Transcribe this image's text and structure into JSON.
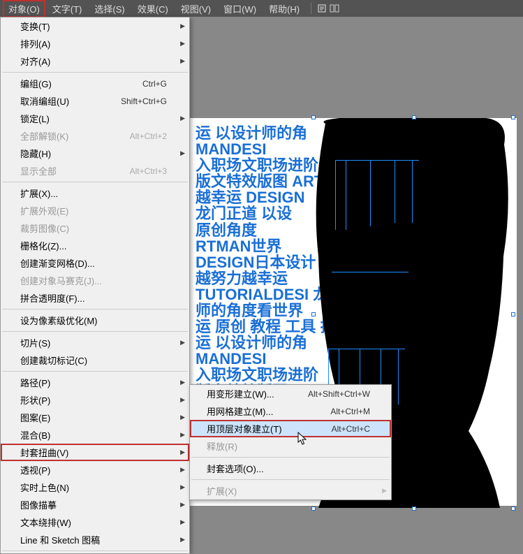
{
  "menubar": {
    "items": [
      {
        "label": "对象(O)",
        "active": true
      },
      {
        "label": "文字(T)"
      },
      {
        "label": "选择(S)"
      },
      {
        "label": "效果(C)"
      },
      {
        "label": "视图(V)"
      },
      {
        "label": "窗口(W)"
      },
      {
        "label": "帮助(H)"
      }
    ]
  },
  "object_menu": {
    "items": [
      {
        "label": "变换(T)",
        "sub": true
      },
      {
        "label": "排列(A)",
        "sub": true
      },
      {
        "label": "对齐(A)",
        "sub": true
      },
      {
        "sep": true
      },
      {
        "label": "编组(G)",
        "shortcut": "Ctrl+G"
      },
      {
        "label": "取消编组(U)",
        "shortcut": "Shift+Ctrl+G"
      },
      {
        "label": "锁定(L)",
        "sub": true
      },
      {
        "label": "全部解锁(K)",
        "shortcut": "Alt+Ctrl+2",
        "disabled": true
      },
      {
        "label": "隐藏(H)",
        "sub": true
      },
      {
        "label": "显示全部",
        "shortcut": "Alt+Ctrl+3",
        "disabled": true
      },
      {
        "sep": true
      },
      {
        "label": "扩展(X)..."
      },
      {
        "label": "扩展外观(E)",
        "disabled": true
      },
      {
        "label": "裁剪图像(C)",
        "disabled": true
      },
      {
        "label": "栅格化(Z)..."
      },
      {
        "label": "创建渐变网格(D)..."
      },
      {
        "label": "创建对象马赛克(J)...",
        "disabled": true
      },
      {
        "label": "拼合透明度(F)..."
      },
      {
        "sep": true
      },
      {
        "label": "设为像素级优化(M)"
      },
      {
        "sep": true
      },
      {
        "label": "切片(S)",
        "sub": true
      },
      {
        "label": "创建裁切标记(C)"
      },
      {
        "sep": true
      },
      {
        "label": "路径(P)",
        "sub": true
      },
      {
        "label": "形状(P)",
        "sub": true
      },
      {
        "label": "图案(E)",
        "sub": true
      },
      {
        "label": "混合(B)",
        "sub": true
      },
      {
        "label": "封套扭曲(V)",
        "sub": true,
        "highlight": true
      },
      {
        "label": "透视(P)",
        "sub": true
      },
      {
        "label": "实时上色(N)",
        "sub": true
      },
      {
        "label": "图像描摹",
        "sub": true
      },
      {
        "label": "文本绕排(W)",
        "sub": true
      },
      {
        "label": "Line 和 Sketch 图稿",
        "sub": true
      },
      {
        "sep": true
      }
    ]
  },
  "envelope_submenu": {
    "items": [
      {
        "label": "用变形建立(W)...",
        "shortcut": "Alt+Shift+Ctrl+W"
      },
      {
        "label": "用网格建立(M)...",
        "shortcut": "Alt+Ctrl+M"
      },
      {
        "label": "用顶层对象建立(T)",
        "shortcut": "Alt+Ctrl+C",
        "highlight": true
      },
      {
        "label": "释放(R)",
        "disabled": true
      },
      {
        "sep": true
      },
      {
        "label": "封套选项(O)..."
      },
      {
        "sep": true
      },
      {
        "label": "扩展(X)",
        "disabled": true
      }
    ]
  },
  "artwork": {
    "bg_text": "运 以设计师的角\nMANDESI\n入职场文职场进阶\n版文特效版图 ARTMAN\n越幸运 DESIGN\n龙门正道 以设\n原创角度\nRTMAN世界\nDESIGN日本设计\n越努力越幸运\nTUTORIALDESI 龙门正道\n师的角度看世界\n运 原创 教程 工具 排版\n运 以设计师的角\nMANDESI\n入职场文职场进阶\n版文特效版图 ARTMAN 庞\n越幸运 门\n"
  }
}
